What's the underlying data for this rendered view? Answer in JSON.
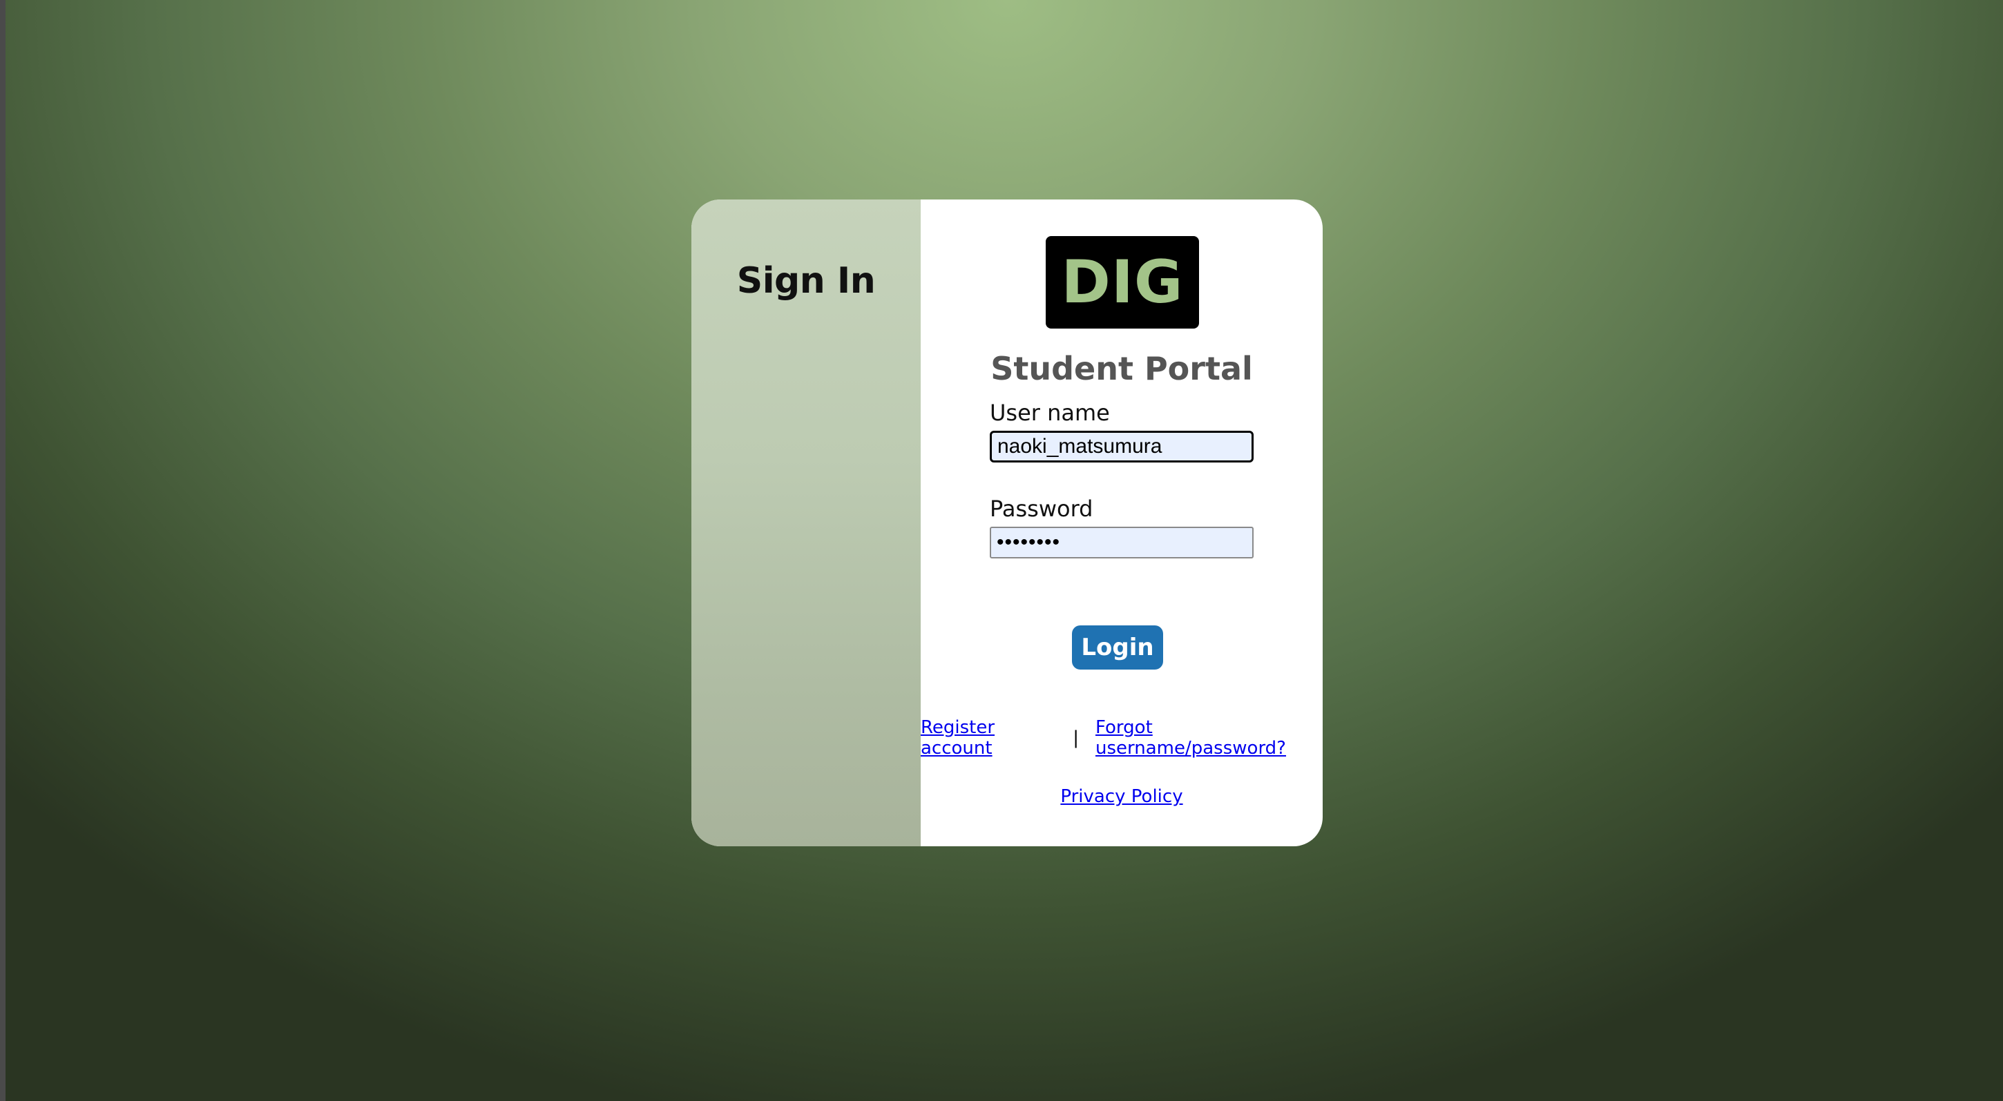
{
  "page": {
    "background_top_color": "#9ebd84",
    "background_bottom_color": "#2a3522"
  },
  "sidebar": {
    "title": "Sign In"
  },
  "logo": {
    "text": "DIG",
    "background_color": "#000000",
    "text_color": "#a3c489"
  },
  "form": {
    "portal_title": "Student Portal",
    "username_label": "User name",
    "username_value": "naoki_matsumura",
    "password_label": "Password",
    "password_value": "••••••••",
    "login_label": "Login",
    "login_color": "#1f72b2"
  },
  "links": {
    "register": "Register account",
    "separator": "|",
    "forgot": "Forgot username/password?",
    "privacy": "Privacy Policy"
  }
}
